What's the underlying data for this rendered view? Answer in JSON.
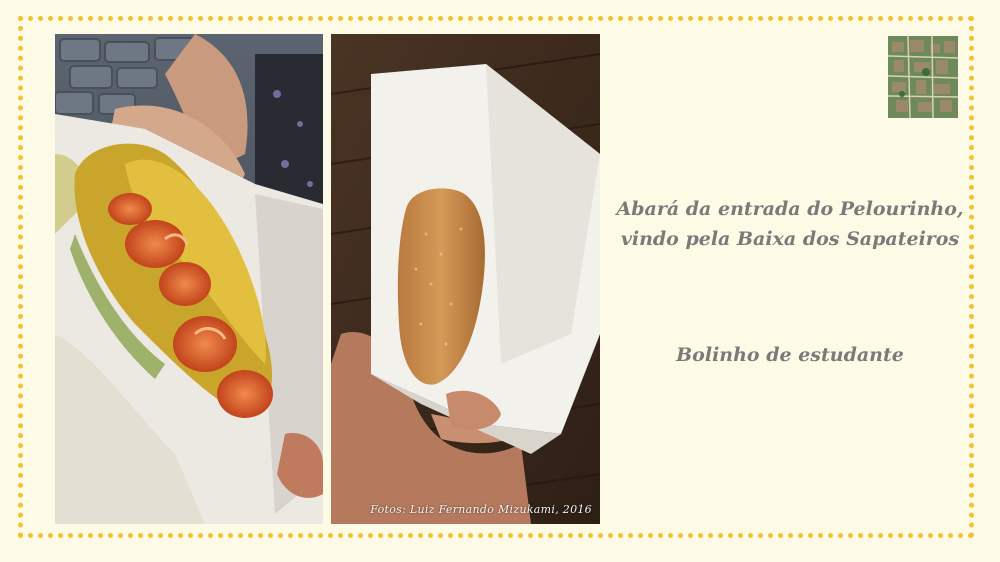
{
  "slide": {
    "caption_abara_line1": "Abará da entrada do Pelourinho,",
    "caption_abara_line2": "vindo pela Baixa dos Sapateiros",
    "caption_bolinho": "Bolinho de estudante",
    "photo_credit": "Fotos: Luiz Fernando  Mizukami, 2016"
  },
  "colors": {
    "background": "#fdfbe6",
    "border": "#f1c232",
    "caption_text": "#7a7a7a"
  },
  "images": {
    "left_photo": "abara-photo",
    "right_photo": "bolinho-de-estudante-photo",
    "top_right": "map-thumbnail"
  }
}
